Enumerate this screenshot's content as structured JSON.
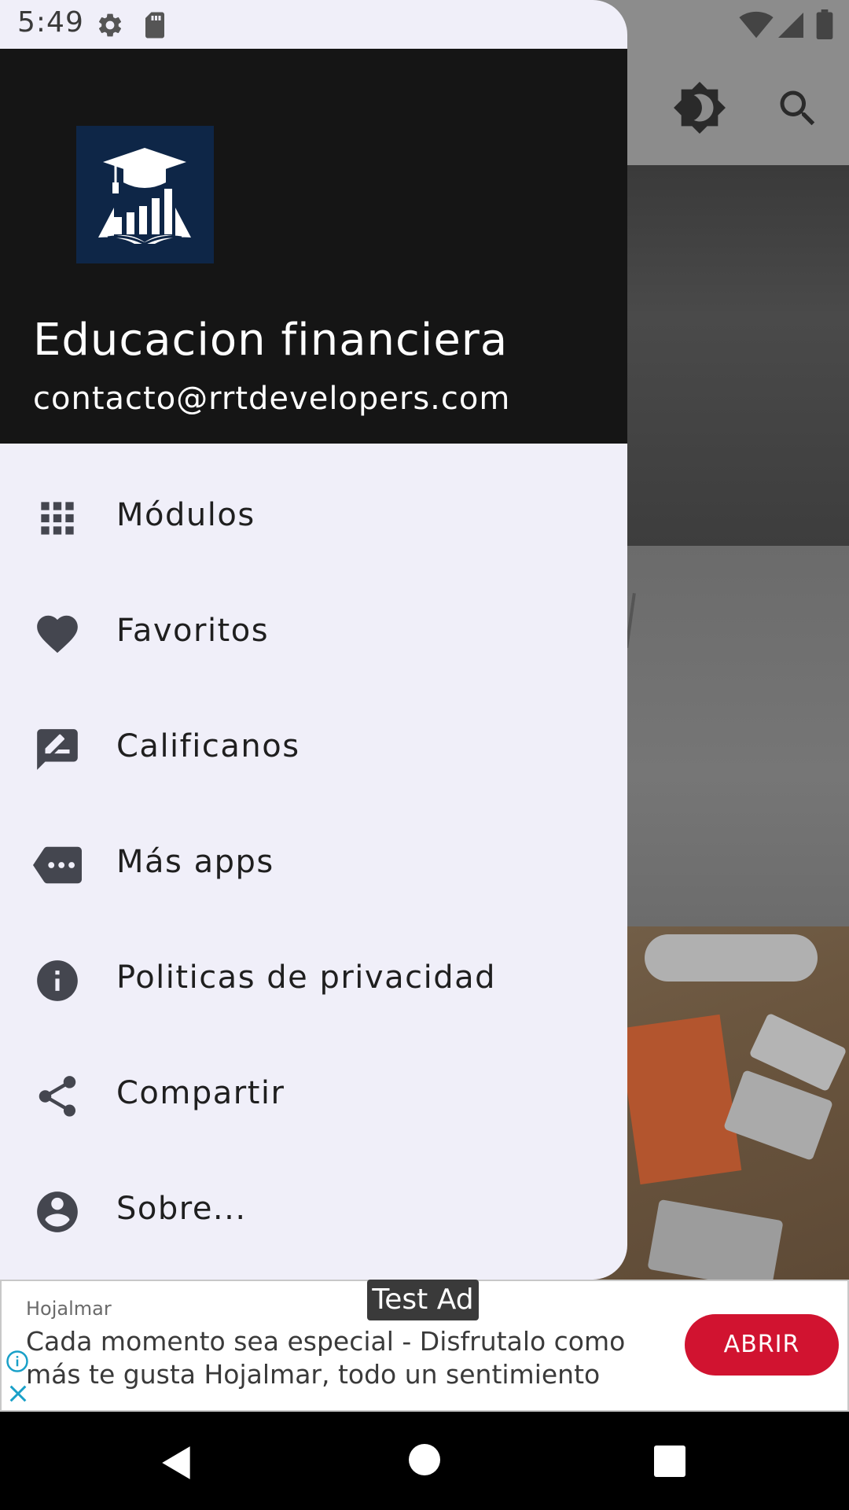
{
  "status_bar": {
    "time": "5:49"
  },
  "drawer": {
    "title": "Educacion financiera",
    "email": "contacto@rrtdevelopers.com",
    "items": [
      {
        "label": "Módulos",
        "icon": "grid-icon"
      },
      {
        "label": "Favoritos",
        "icon": "heart-icon"
      },
      {
        "label": "Calificanos",
        "icon": "rate-review-icon"
      },
      {
        "label": "Más apps",
        "icon": "more-apps-icon"
      },
      {
        "label": "Politicas de privacidad",
        "icon": "info-icon"
      },
      {
        "label": "Compartir",
        "icon": "share-icon"
      },
      {
        "label": "Sobre...",
        "icon": "account-circle-icon"
      }
    ]
  },
  "ad": {
    "test_label": "Test Ad",
    "advertiser": "Hojalmar",
    "text_line_1": "Cada momento sea especial - Disfrutalo como",
    "text_line_2": "más te gusta Hojalmar, todo un sentimiento",
    "button": "ABRIR"
  },
  "colors": {
    "drawer_background": "#f0eff9",
    "header_background": "#151515",
    "logo_background": "#0e2647",
    "ad_button": "#d11330"
  }
}
